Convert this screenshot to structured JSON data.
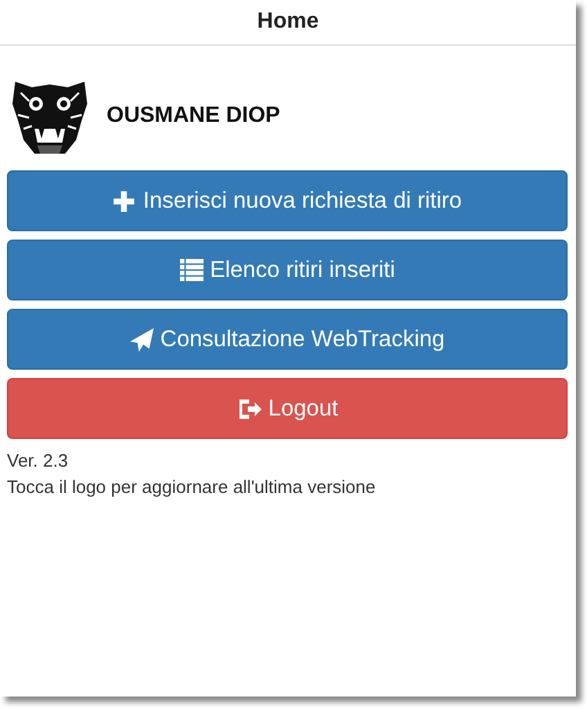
{
  "header": {
    "title": "Home"
  },
  "user": {
    "name": "OUSMANE DIOP"
  },
  "buttons": [
    {
      "label": "Inserisci nuova richiesta di ritiro",
      "kind": "primary"
    },
    {
      "label": "Elenco ritiri inseriti",
      "kind": "primary"
    },
    {
      "label": "Consultazione WebTracking",
      "kind": "primary"
    },
    {
      "label": "Logout",
      "kind": "danger"
    }
  ],
  "footer": {
    "version": "Ver. 2.3",
    "hint": "Tocca il logo per aggiornare all'ultima versione"
  }
}
